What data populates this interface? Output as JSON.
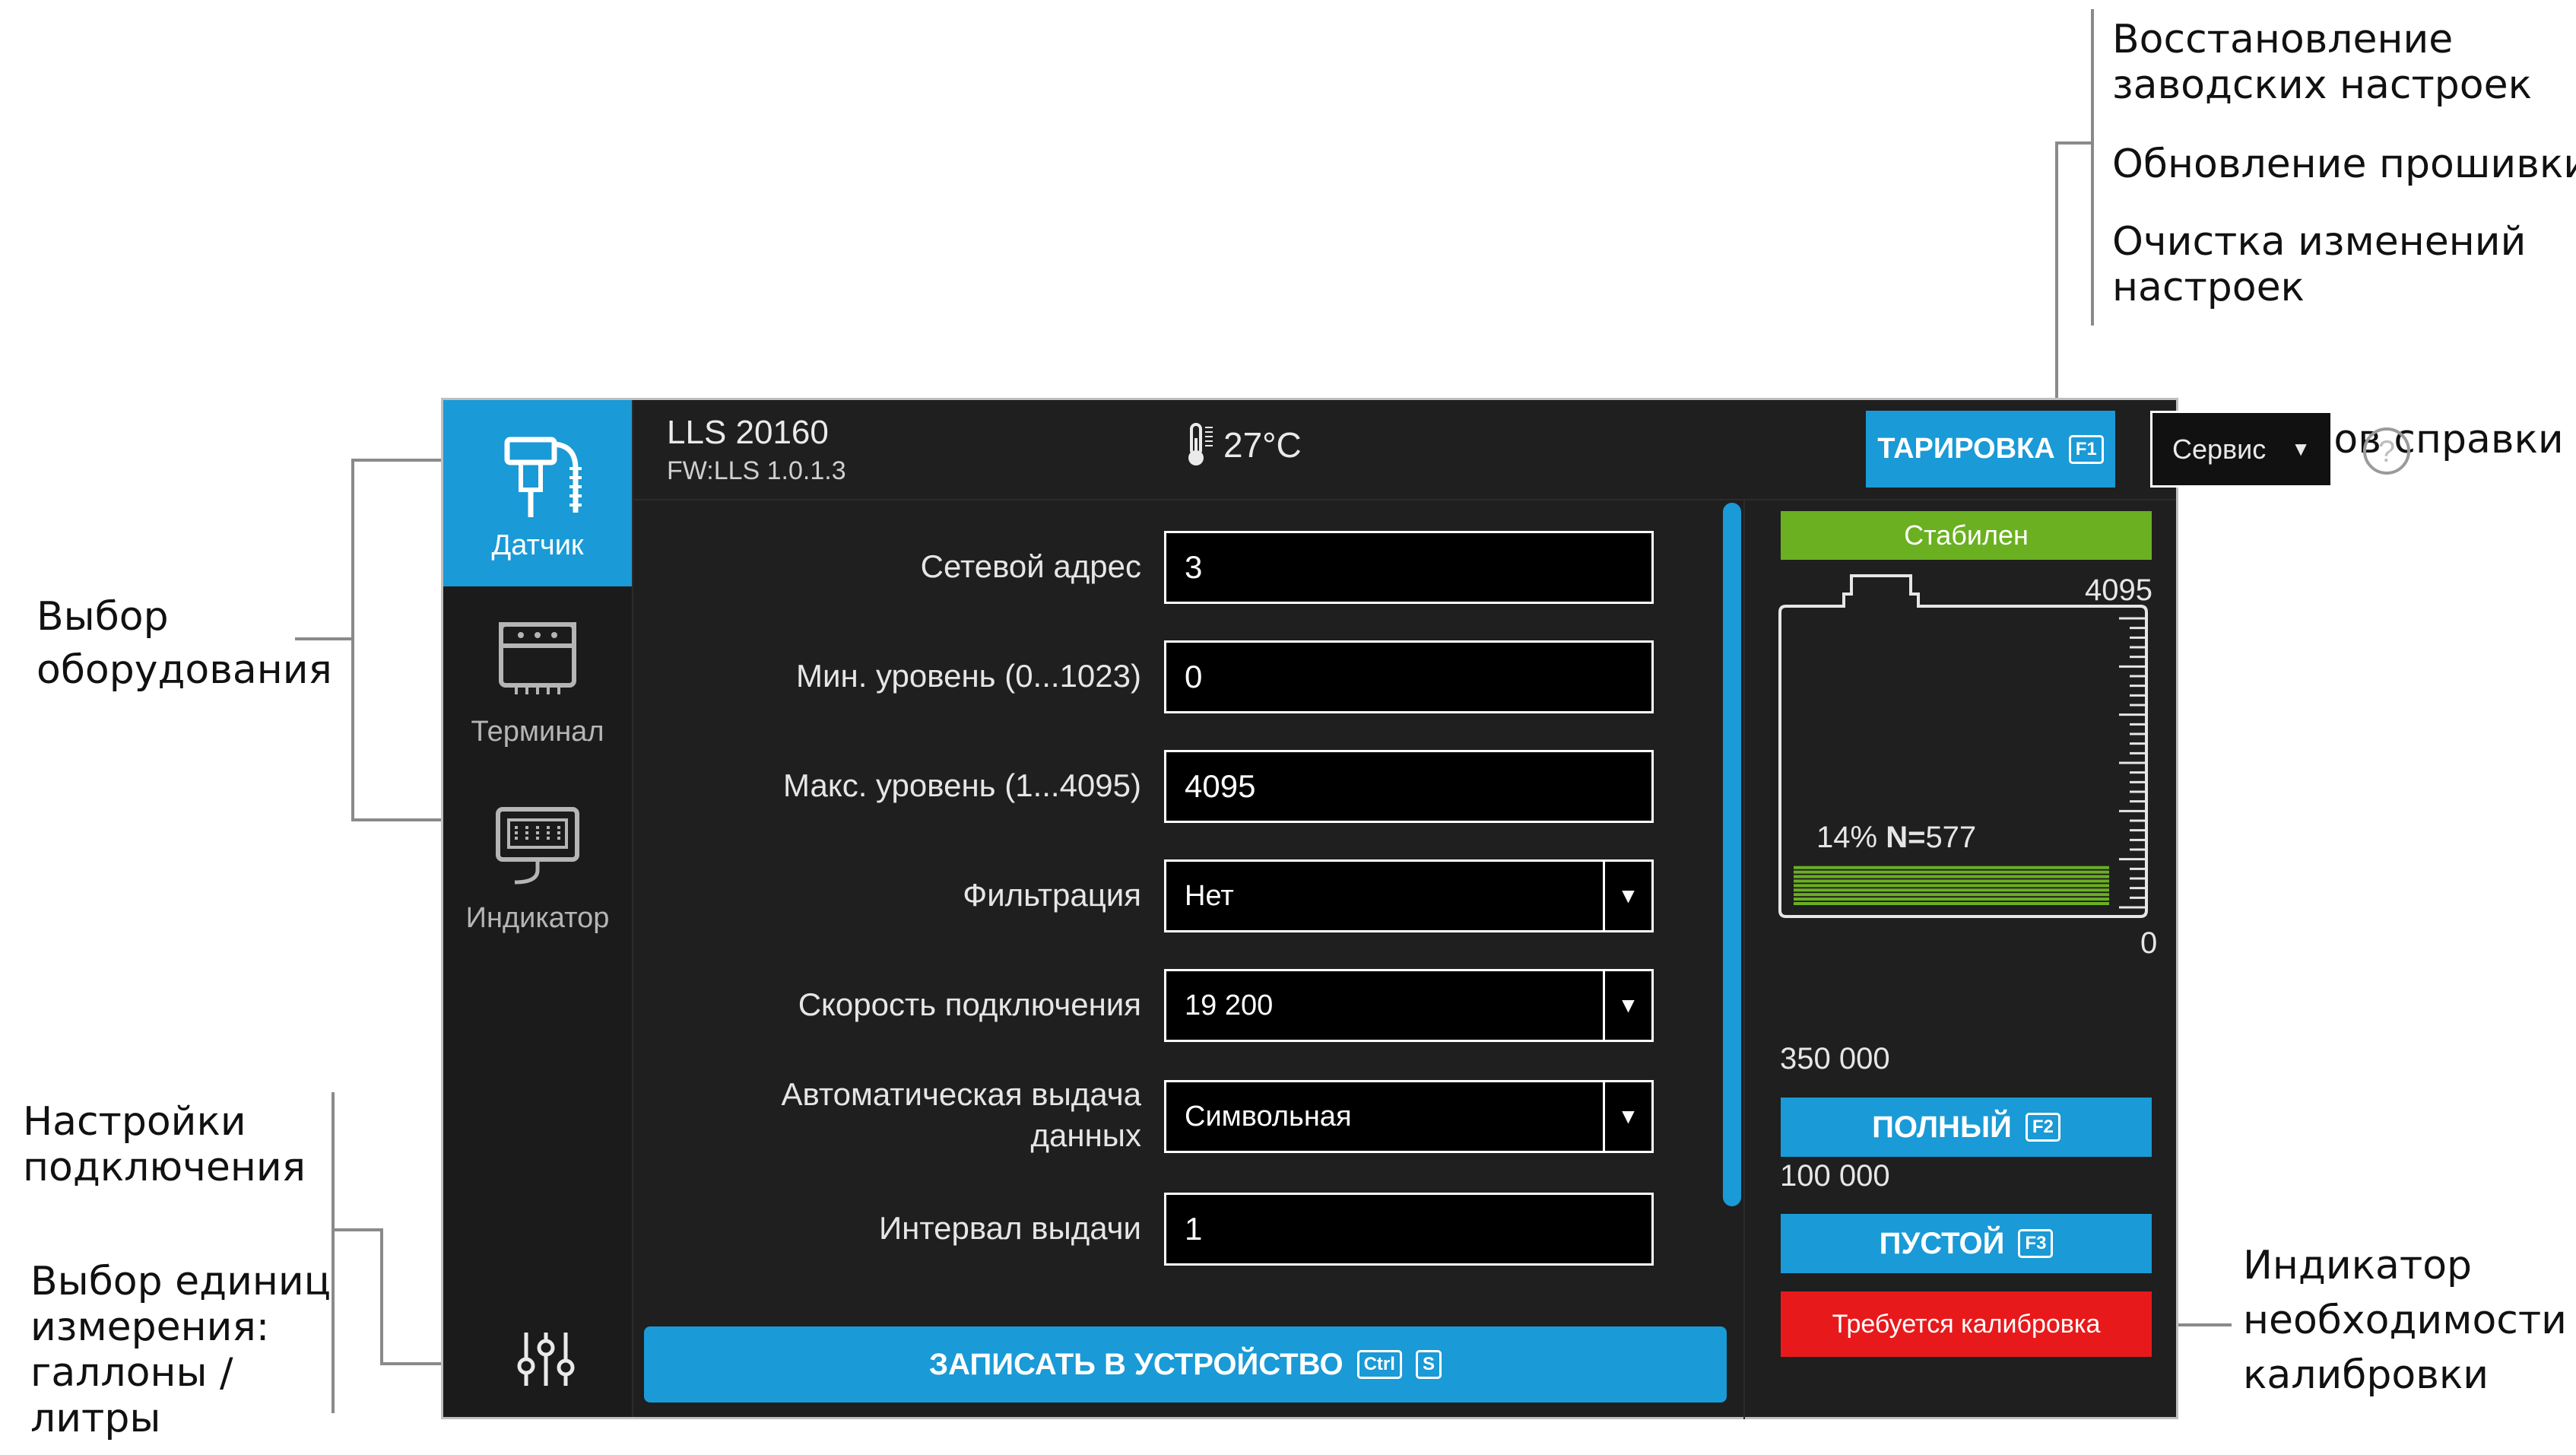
{
  "callouts": {
    "factory_reset": "Восстановление\nзаводских настроек",
    "firmware_update": "Обновление прошивки",
    "clear_changes": "Очистка изменений\nнастроек",
    "help_call": "Вызов справки",
    "equipment_select": "Выбор\nоборудования",
    "connection_settings": "Настройки\nподключения",
    "units_select": "Выбор единиц\nизмерения:\nгаллоны /\nлитры",
    "calibration_indicator": "Индикатор\nнеобходимости\nкалибровки"
  },
  "sidebar": {
    "items": [
      {
        "label": "Датчик",
        "active": true
      },
      {
        "label": "Терминал",
        "active": false
      },
      {
        "label": "Индикатор",
        "active": false
      }
    ],
    "settings_icon": "sliders-icon"
  },
  "header": {
    "model": "LLS 20160",
    "firmware": "FW:LLS 1.0.1.3",
    "temperature": "27°C",
    "tare_label": "ТАРИРОВКА",
    "tare_key": "F1",
    "service_label": "Сервис",
    "help_symbol": "?"
  },
  "form": {
    "fields": [
      {
        "label": "Сетевой адрес",
        "value": "3"
      },
      {
        "label": "Мин. уровень (0...1023)",
        "value": "0"
      },
      {
        "label": "Макс. уровень (1...4095)",
        "value": "4095"
      },
      {
        "label": "Фильтрация",
        "value": "Нет"
      },
      {
        "label": "Скорость подключения",
        "value": "19 200"
      },
      {
        "label": "Автоматическая выдача данных",
        "value": "Символьная"
      },
      {
        "label": "Интервал выдачи",
        "value": "1"
      }
    ],
    "write_label": "ЗАПИСАТЬ В УСТРОЙСТВО",
    "write_keys": [
      "Ctrl",
      "S"
    ]
  },
  "panel": {
    "status": "Стабилен",
    "max_value": "4095",
    "min_value": "0",
    "percent": "14%",
    "n_label": "N=",
    "n_value": "577",
    "fill_fraction": 0.14,
    "full_value": "350 000",
    "full_label": "ПОЛНЫЙ",
    "full_key": "F2",
    "empty_value": "100 000",
    "empty_label": "ПУСТОЙ",
    "empty_key": "F3",
    "calibration": "Требуется калибровка"
  },
  "colors": {
    "accent": "#1a9ad6",
    "stable": "#6ab021",
    "alert": "#e8191b",
    "level": "#6ab021"
  }
}
